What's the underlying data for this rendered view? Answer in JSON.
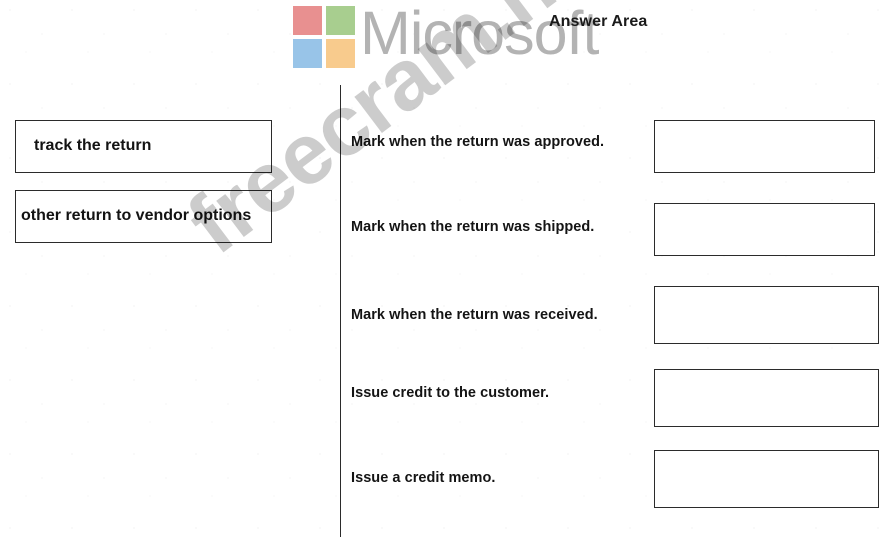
{
  "branding": {
    "logo_name": "microsoft-logo",
    "wordmark": "Microsoft",
    "wordmark_color": "#b3b3b3",
    "logo_colors": {
      "top_left": "#e89090",
      "top_right": "#a8ce8f",
      "bottom_left": "#98c4e8",
      "bottom_right": "#f8cb8d"
    }
  },
  "header": {
    "answer_area_title": "Answer Area"
  },
  "left_panel": {
    "options": [
      {
        "label": "track the return"
      },
      {
        "label": "other return to vendor options"
      }
    ]
  },
  "answer_area": {
    "rows": [
      {
        "label": "Mark when the return was approved.",
        "value": ""
      },
      {
        "label": "Mark when the return was shipped.",
        "value": ""
      },
      {
        "label": "Mark when the return was received.",
        "value": ""
      },
      {
        "label": "Issue credit to the customer.",
        "value": ""
      },
      {
        "label": "Issue a credit memo.",
        "value": ""
      }
    ]
  },
  "watermark": {
    "text": "freecram.net"
  }
}
